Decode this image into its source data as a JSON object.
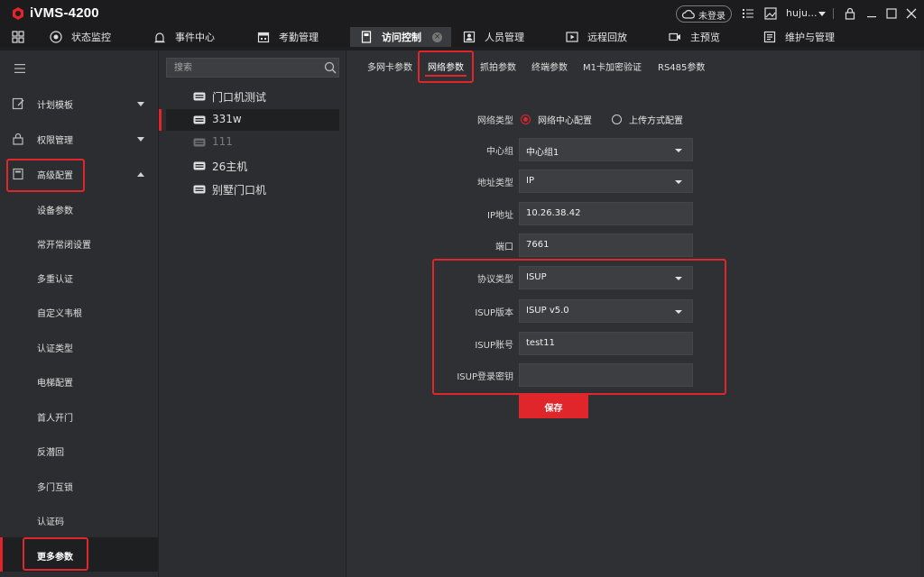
{
  "app": {
    "title": "iVMS-4200",
    "login_status": "未登录",
    "username": "huju...",
    "brand_color": "#e0252b"
  },
  "nav": {
    "items": [
      {
        "label": "状态监控",
        "icon": "status-monitor-icon"
      },
      {
        "label": "事件中心",
        "icon": "alarm-icon"
      },
      {
        "label": "考勤管理",
        "icon": "calendar-icon"
      },
      {
        "label": "访问控制",
        "icon": "door-icon",
        "active": true
      },
      {
        "label": "人员管理",
        "icon": "person-icon"
      },
      {
        "label": "远程回放",
        "icon": "playback-icon"
      },
      {
        "label": "主预览",
        "icon": "camera-icon"
      },
      {
        "label": "维护与管理",
        "icon": "maintenance-icon"
      }
    ]
  },
  "sidebar": {
    "groups": [
      {
        "label": "计划模板",
        "icon": "template-icon",
        "expanded": false
      },
      {
        "label": "权限管理",
        "icon": "lock-icon",
        "expanded": false
      },
      {
        "label": "高级配置",
        "icon": "config-icon",
        "expanded": true
      }
    ],
    "sub_items": [
      "设备参数",
      "常开常闭设置",
      "多重认证",
      "自定义韦根",
      "认证类型",
      "电梯配置",
      "首人开门",
      "反潜回",
      "多门互锁",
      "认证码",
      "更多参数"
    ],
    "active_sub": "更多参数"
  },
  "devices": {
    "search_placeholder": "搜索",
    "items": [
      {
        "label": "门口机测试",
        "status": "online"
      },
      {
        "label": "331w",
        "status": "online",
        "selected": true
      },
      {
        "label": "111",
        "status": "offline"
      },
      {
        "label": "26主机",
        "status": "online"
      },
      {
        "label": "别墅门口机",
        "status": "online"
      }
    ]
  },
  "tabs": {
    "items": [
      "多网卡参数",
      "网络参数",
      "抓拍参数",
      "终端参数",
      "M1卡加密验证",
      "RS485参数"
    ],
    "active": "网络参数"
  },
  "form": {
    "network_type": {
      "label": "网络类型",
      "options": [
        "网络中心配置",
        "上传方式配置"
      ],
      "selected": "网络中心配置"
    },
    "center_group": {
      "label": "中心组",
      "value": "中心组1"
    },
    "address_type": {
      "label": "地址类型",
      "value": "IP"
    },
    "ip_address": {
      "label": "IP地址",
      "value": "10.26.38.42"
    },
    "port": {
      "label": "端口",
      "value": "7661"
    },
    "protocol_type": {
      "label": "协议类型",
      "value": "ISUP"
    },
    "isup_version": {
      "label": "ISUP版本",
      "value": "ISUP v5.0"
    },
    "isup_account": {
      "label": "ISUP账号",
      "value": "test11"
    },
    "isup_key": {
      "label": "ISUP登录密钥",
      "value": ""
    },
    "save_label": "保存"
  }
}
